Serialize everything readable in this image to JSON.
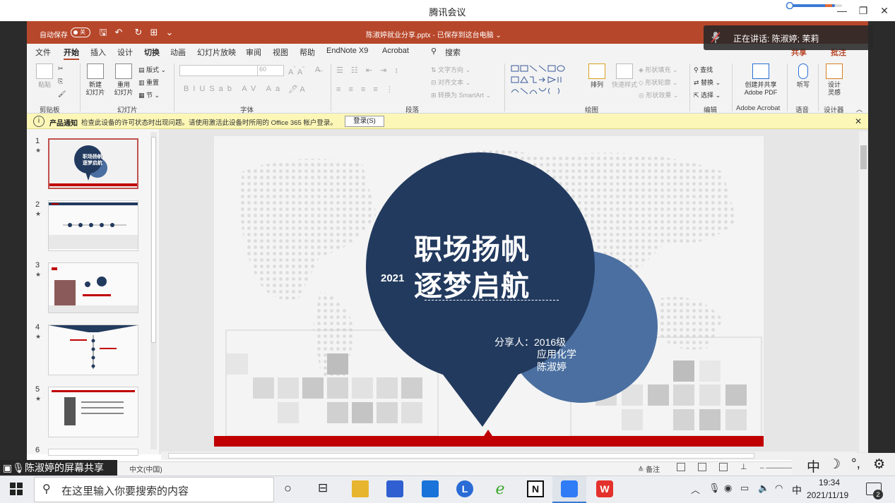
{
  "meeting": {
    "title": "腾讯会议"
  },
  "ppt": {
    "autosave_label": "自动保存",
    "autosave_state": "关",
    "doc_title": "陈淑婷就业分享.pptx - 已保存到这台电脑 ⌄",
    "tabs": [
      "文件",
      "开始",
      "插入",
      "设计",
      "切换",
      "动画",
      "幻灯片放映",
      "审阅",
      "视图",
      "帮助",
      "EndNote X9",
      "Acrobat"
    ],
    "search_label": "搜索",
    "share_label": "共享",
    "comment_label": "批注"
  },
  "ribbon": {
    "paste": "粘贴",
    "new_slide": "新建\n幻灯片",
    "reuse_slide": "重用\n幻灯片",
    "layout": "版式",
    "reset": "重置",
    "section": "节",
    "font_size": "60",
    "text_direction": "文字方向",
    "align_text": "对齐文本",
    "smartart": "转换为 SmartArt",
    "arrange": "排列",
    "quick_styles": "快速样式",
    "shape_fill": "形状填充",
    "shape_outline": "形状轮廓",
    "shape_effects": "形状效果",
    "find": "查找",
    "replace": "替换",
    "select": "选择",
    "create_share_pdf": "创建并共享\nAdobe PDF",
    "dictate": "听写",
    "designer": "设计\n灵感",
    "groups": {
      "clipboard": "剪贴板",
      "slides": "幻灯片",
      "font": "字体",
      "paragraph": "段落",
      "drawing": "绘图",
      "editing": "编辑",
      "acrobat": "Adobe Acrobat",
      "voice": "语音",
      "designer": "设计器"
    }
  },
  "notification": {
    "label": "产品通知",
    "message": "检查此设备的许可状态时出现问题。请使用激活此设备时所用的 Office 365 帐户登录。",
    "login_button": "登录(S)"
  },
  "thumbnails": [
    {
      "num": "1",
      "star": "★"
    },
    {
      "num": "2",
      "star": "★"
    },
    {
      "num": "3",
      "star": "★"
    },
    {
      "num": "4",
      "star": "★"
    },
    {
      "num": "5",
      "star": "★"
    },
    {
      "num": "6",
      "star": ""
    }
  ],
  "slide": {
    "title_line1": "职场扬帆",
    "title_line2": "逐梦启航",
    "year": "2021",
    "presenter_label": "分享人：2016级",
    "presenter_line2": "应用化学",
    "presenter_line3": "陈淑婷",
    "colors": {
      "navy": "#223a5e",
      "blue": "#4a6fa0",
      "red": "#c00000"
    }
  },
  "statusbar": {
    "language": "中文(中国)",
    "notes": "备注"
  },
  "screen_share": {
    "label": "陈淑婷的屏幕共享"
  },
  "speaking": {
    "text": "正在讲话: 陈淑婷; 茉莉"
  },
  "ime_float": [
    "中",
    "☽",
    "°,",
    "⚙"
  ],
  "taskbar": {
    "search_placeholder": "在这里输入你要搜索的内容",
    "time": "19:34",
    "date": "2021/11/19",
    "ime": "中",
    "notification_count": "2"
  }
}
